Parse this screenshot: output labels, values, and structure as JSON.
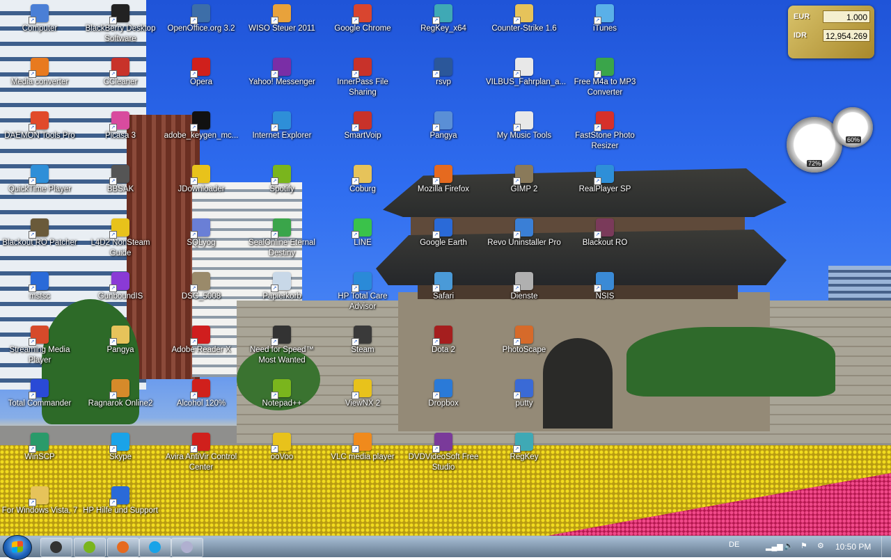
{
  "desktop_icons": [
    {
      "label": "Computer",
      "icon": "computer-icon",
      "color": "#4a7fd6"
    },
    {
      "label": "BlackBerry Desktop Software",
      "icon": "blackberry-icon",
      "color": "#222222"
    },
    {
      "label": "OpenOffice.org 3.2",
      "icon": "openoffice-icon",
      "color": "#3d6ea8"
    },
    {
      "label": "WISO Steuer 2011",
      "icon": "wiso-icon",
      "color": "#e8a23b"
    },
    {
      "label": "Google Chrome",
      "icon": "chrome-icon",
      "color": "#d9452f"
    },
    {
      "label": "RegKey_x64",
      "icon": "regkey-icon",
      "color": "#3fa9b5"
    },
    {
      "label": "Counter-Strike 1.6",
      "icon": "folder-icon",
      "color": "#e6c35a"
    },
    {
      "label": "iTunes",
      "icon": "itunes-icon",
      "color": "#5ab0e8"
    },
    {
      "label": "Media converter",
      "icon": "media-converter-icon",
      "color": "#e87a1f"
    },
    {
      "label": "CCleaner",
      "icon": "ccleaner-icon",
      "color": "#c8322a"
    },
    {
      "label": "Opera",
      "icon": "opera-icon",
      "color": "#d0201c"
    },
    {
      "label": "Yahoo! Messenger",
      "icon": "yahoo-icon",
      "color": "#7a2ea6"
    },
    {
      "label": "InnerPass File Sharing",
      "icon": "innerpass-icon",
      "color": "#c8322a"
    },
    {
      "label": "rsvp",
      "icon": "word-doc-icon",
      "color": "#2b579a"
    },
    {
      "label": "VILBUS_Fahrplan_a...",
      "icon": "document-icon",
      "color": "#e8e8e8"
    },
    {
      "label": "Free M4a to MP3 Converter",
      "icon": "m4a-converter-icon",
      "color": "#3aa54a"
    },
    {
      "label": "DAEMON Tools Pro",
      "icon": "daemon-tools-icon",
      "color": "#e14a2a"
    },
    {
      "label": "Picasa 3",
      "icon": "picasa-icon",
      "color": "#d84b9e"
    },
    {
      "label": "adobe_keygen_mc...",
      "icon": "keygen-icon",
      "color": "#111111"
    },
    {
      "label": "Internet Explorer",
      "icon": "ie-icon",
      "color": "#2e8fd8"
    },
    {
      "label": "SmartVoip",
      "icon": "smartvoip-icon",
      "color": "#c8322a"
    },
    {
      "label": "Pangya",
      "icon": "pangya-icon",
      "color": "#5a8fd6"
    },
    {
      "label": "My Music Tools",
      "icon": "document-icon",
      "color": "#e8e8e8"
    },
    {
      "label": "FastStone Photo Resizer",
      "icon": "faststone-icon",
      "color": "#d6302a"
    },
    {
      "label": "QuickTime Player",
      "icon": "quicktime-icon",
      "color": "#2e8fd8"
    },
    {
      "label": "BBSAK",
      "icon": "bbsak-icon",
      "color": "#555555"
    },
    {
      "label": "JDownloader",
      "icon": "jdownloader-icon",
      "color": "#e8c21b"
    },
    {
      "label": "Spotify",
      "icon": "spotify-icon",
      "color": "#7ab51d"
    },
    {
      "label": "Coburg",
      "icon": "folder-icon",
      "color": "#e6c35a"
    },
    {
      "label": "Mozilla Firefox",
      "icon": "firefox-icon",
      "color": "#e66a1f"
    },
    {
      "label": "GIMP 2",
      "icon": "gimp-icon",
      "color": "#8a7a5a"
    },
    {
      "label": "RealPlayer SP",
      "icon": "realplayer-icon",
      "color": "#2e8fd8"
    },
    {
      "label": "Blackout RO Patcher",
      "icon": "patcher-icon",
      "color": "#6a5a3a"
    },
    {
      "label": "L4D2 NonSteam Guide",
      "icon": "help-file-icon",
      "color": "#e8c21b"
    },
    {
      "label": "SQLyog",
      "icon": "sqlyog-icon",
      "color": "#6a7fd6"
    },
    {
      "label": "SealOnline Eternal Destiny",
      "icon": "sealonline-icon",
      "color": "#3aa54a"
    },
    {
      "label": "LINE",
      "icon": "line-icon",
      "color": "#3ac24a"
    },
    {
      "label": "Google Earth",
      "icon": "google-earth-icon",
      "color": "#2a6ad8"
    },
    {
      "label": "Revo Uninstaller Pro",
      "icon": "revo-icon",
      "color": "#3a7fd6"
    },
    {
      "label": "Blackout RO",
      "icon": "blackout-ro-icon",
      "color": "#7a3a5a"
    },
    {
      "label": "mstsc",
      "icon": "remote-desktop-icon",
      "color": "#2a6ad8"
    },
    {
      "label": "GunboundIS",
      "icon": "gunbound-icon",
      "color": "#8a3ad6"
    },
    {
      "label": "DSC_5008",
      "icon": "image-file-icon",
      "color": "#9a8a6a"
    },
    {
      "label": "Papierkorb",
      "icon": "recycle-bin-icon",
      "color": "#c8d8e8"
    },
    {
      "label": "HP Total Care Advisor",
      "icon": "hp-advisor-icon",
      "color": "#2a8ad8"
    },
    {
      "label": "Safari",
      "icon": "safari-icon",
      "color": "#4a9ad8"
    },
    {
      "label": "Dienste",
      "icon": "services-icon",
      "color": "#b0b0b0"
    },
    {
      "label": "NSIS",
      "icon": "nsis-icon",
      "color": "#3a8ad6"
    },
    {
      "label": "Streaming Media Player",
      "icon": "streaming-icon",
      "color": "#d64a2a"
    },
    {
      "label": "Pangya",
      "icon": "folder-icon",
      "color": "#e6c35a"
    },
    {
      "label": "Adobe Reader X",
      "icon": "adobe-reader-icon",
      "color": "#d01e1e"
    },
    {
      "label": "Need for Speed™ Most Wanted",
      "icon": "nfs-icon",
      "color": "#333333"
    },
    {
      "label": "Steam",
      "icon": "steam-icon",
      "color": "#3a3a3a"
    },
    {
      "label": "Dota 2",
      "icon": "dota2-icon",
      "color": "#a51e1e"
    },
    {
      "label": "PhotoScape",
      "icon": "photoscape-icon",
      "color": "#d66a2a"
    },
    {
      "label": "Total Commander",
      "icon": "total-commander-icon",
      "color": "#2a4ad6"
    },
    {
      "label": "Ragnarok Online2",
      "icon": "ragnarok-icon",
      "color": "#d68a2a"
    },
    {
      "label": "Alcohol 120%",
      "icon": "alcohol-icon",
      "color": "#d0201c"
    },
    {
      "label": "Notepad++",
      "icon": "notepad-plus-icon",
      "color": "#7ab51d"
    },
    {
      "label": "ViewNX 2",
      "icon": "viewnx-icon",
      "color": "#e8c21b"
    },
    {
      "label": "Dropbox",
      "icon": "dropbox-icon",
      "color": "#2a7ad8"
    },
    {
      "label": "putty",
      "icon": "putty-icon",
      "color": "#3a6ad6"
    },
    {
      "label": "WinSCP",
      "icon": "winscp-icon",
      "color": "#2a9a6a"
    },
    {
      "label": "Skype",
      "icon": "skype-icon",
      "color": "#1aa3e8"
    },
    {
      "label": "Avira AntiVir Control Center",
      "icon": "avira-icon",
      "color": "#d0201c"
    },
    {
      "label": "ooVoo",
      "icon": "oovoo-icon",
      "color": "#e8c21b"
    },
    {
      "label": "VLC media player",
      "icon": "vlc-icon",
      "color": "#f08a1c"
    },
    {
      "label": "DVDVideoSoft Free Studio",
      "icon": "dvdvideosoft-icon",
      "color": "#7a3a9a"
    },
    {
      "label": "RegKey",
      "icon": "regkey-icon",
      "color": "#3fa9b5"
    },
    {
      "label": "For Windows Vista, 7",
      "icon": "folder-icon",
      "color": "#e6c35a"
    },
    {
      "label": "HP Hilfe und Support",
      "icon": "help-icon",
      "color": "#2a6ad8"
    }
  ],
  "currency_gadget": {
    "rows": [
      {
        "code": "EUR",
        "value": "1.000"
      },
      {
        "code": "IDR",
        "value": "12,954.269"
      }
    ]
  },
  "cpu_gadget": {
    "cpu_percent": "72%",
    "memory_percent": "60%"
  },
  "taskbar": {
    "pinned": [
      {
        "icon": "media-player-icon",
        "color": "#333333"
      },
      {
        "icon": "spotify-icon",
        "color": "#7ab51d"
      },
      {
        "icon": "firefox-icon",
        "color": "#e66a1f"
      },
      {
        "icon": "skype-icon",
        "color": "#1aa3e8"
      },
      {
        "icon": "paint-icon",
        "color": "#b0b0d0"
      }
    ],
    "language": "DE",
    "clock": "10:50 PM"
  }
}
